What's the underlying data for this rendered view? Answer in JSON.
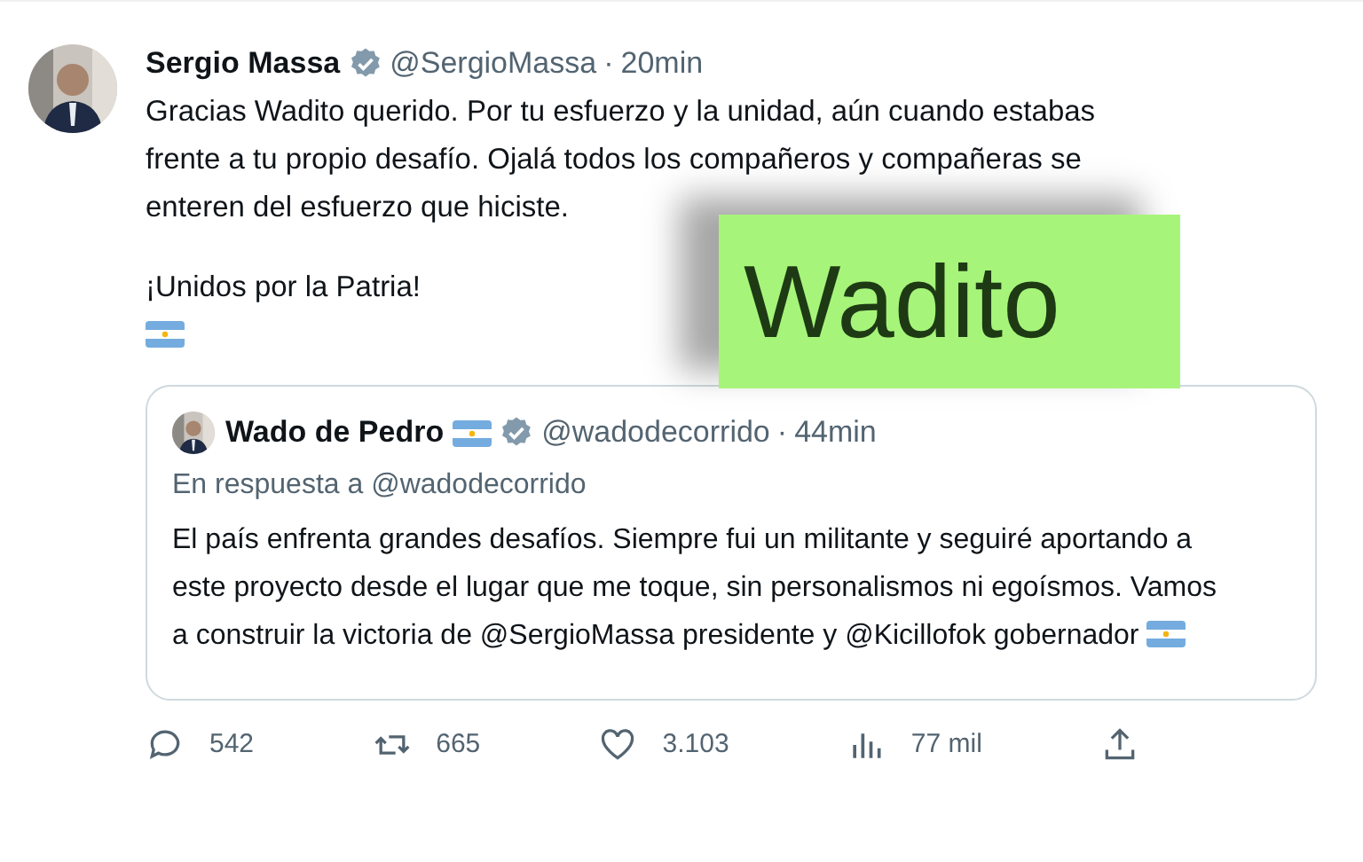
{
  "tweet": {
    "author": "Sergio Massa",
    "verified": true,
    "handle": "@SergioMassa",
    "separator": "·",
    "time": "20min",
    "paragraphs": [
      "Gracias Wadito querido. Por tu esfuerzo y la unidad, aún cuando estabas frente a tu propio desafío. Ojalá todos los compañeros y compañeras se enteren del esfuerzo que hiciste.",
      "¡Unidos por la Patria!"
    ],
    "trailing_flag": true,
    "overlay": {
      "text": "Wadito",
      "color": "#a6f57a"
    },
    "quote": {
      "author": "Wado de Pedro",
      "author_flag": true,
      "verified": true,
      "handle": "@wadodecorrido",
      "separator": "·",
      "time": "44min",
      "reply_label": "En respuesta a @wadodecorrido",
      "text": "El país enfrenta grandes desafíos. Siempre fui un militante y seguiré aportando a este proyecto desde el lugar que me toque, sin personalismos ni egoísmos. Vamos a construir la victoria de @SergioMassa presidente y @Kicillofok gobernador",
      "text_flag": true
    },
    "actions": [
      {
        "kind": "reply",
        "count": "542"
      },
      {
        "kind": "retweet",
        "count": "665"
      },
      {
        "kind": "like",
        "count": "3.103"
      },
      {
        "kind": "views",
        "count": "77 mil"
      },
      {
        "kind": "share"
      }
    ]
  }
}
